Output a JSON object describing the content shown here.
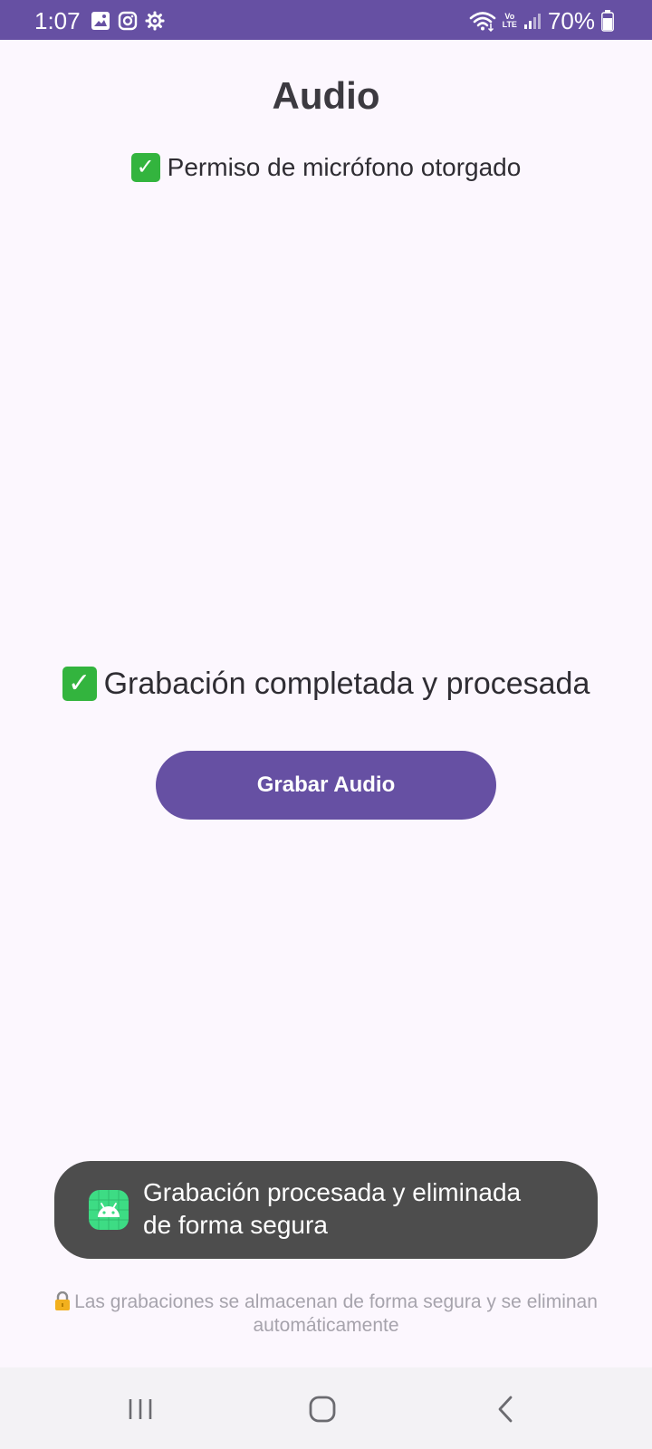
{
  "status_bar": {
    "time": "1:07",
    "volte_top": "Vo",
    "volte_bottom": "LTE",
    "battery_percent": "70%",
    "left_icons": [
      "image-icon",
      "instagram-icon",
      "settings-gear-icon"
    ],
    "right_icons": [
      "wifi-icon",
      "volte-icon",
      "signal-icon",
      "battery-icon"
    ],
    "background_color": "#6650A3"
  },
  "main": {
    "title": "Audio",
    "permission_status": "Permiso de micrófono otorgado",
    "recording_status": "Grabación completada y procesada",
    "record_button_label": "Grabar Audio",
    "status_icon": "check-mark-icon",
    "accent_color": "#6650A3"
  },
  "toast": {
    "message_line1": "Grabación procesada y eliminada",
    "message_line2": "de forma segura",
    "icon": "android-app-icon"
  },
  "footer": {
    "note": "Las grabaciones se almacenan de forma segura y se eliminan automáticamente",
    "icon": "lock-icon"
  },
  "nav_bar": {
    "buttons": [
      "recents-icon",
      "home-icon",
      "back-icon"
    ]
  }
}
